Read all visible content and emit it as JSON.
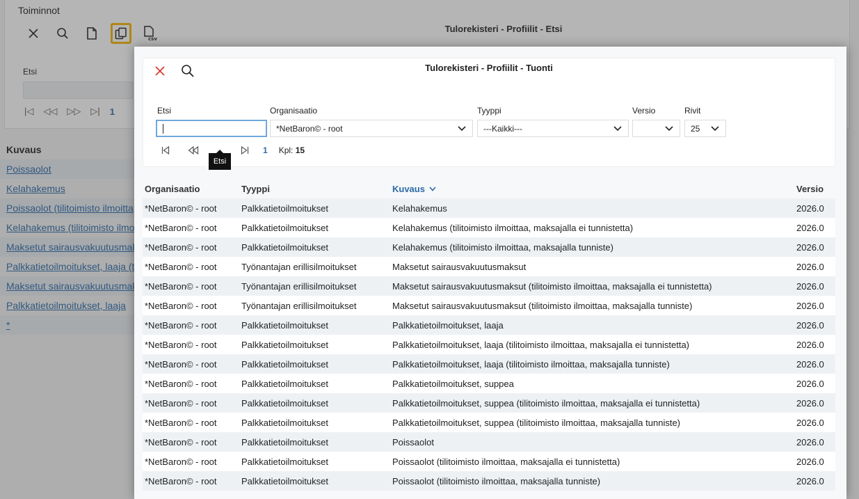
{
  "background": {
    "section_title": "Toiminnot",
    "page_title": "Tulorekisteri - Profiilit - Etsi",
    "search_label": "Etsi",
    "pager_page": "1",
    "list_header": "Kuvaus",
    "list_items": [
      "Poissaolot",
      "Kelahakemus",
      "Poissaolot (tilitoimisto ilmoitta",
      "Kelahakemus (tilitoimisto ilmo",
      "Maksetut sairausvakuutusmak",
      "Palkkatietoilmoitukset, laaja (ti",
      "Maksetut sairausvakuutusmak",
      "Palkkatietoilmoitukset, laaja",
      "*"
    ],
    "toolbar_icons": [
      "close-icon",
      "search-icon",
      "new-document-icon",
      "copy-icon",
      "csv-export-icon"
    ]
  },
  "modal": {
    "title": "Tulorekisteri - Profiilit - Tuonti",
    "filters": {
      "search_label": "Etsi",
      "search_value": "",
      "organisation_label": "Organisaatio",
      "organisation_value": "*NetBaron© - root",
      "type_label": "Tyyppi",
      "type_value": "---Kaikki---",
      "version_label": "Versio",
      "version_value": "",
      "rows_label": "Rivit",
      "rows_value": "25"
    },
    "pager": {
      "page": "1",
      "count_label": "Kpl:",
      "count_value": "15"
    },
    "tooltip": "Etsi",
    "table": {
      "headers": {
        "organisation": "Organisaatio",
        "type": "Tyyppi",
        "description": "Kuvaus",
        "version": "Versio"
      },
      "rows": [
        {
          "org": "*NetBaron© - root",
          "type": "Palkkatietoilmoitukset",
          "desc": "Kelahakemus",
          "version": "2026.0"
        },
        {
          "org": "*NetBaron© - root",
          "type": "Palkkatietoilmoitukset",
          "desc": "Kelahakemus (tilitoimisto ilmoittaa, maksajalla ei tunnistetta)",
          "version": "2026.0"
        },
        {
          "org": "*NetBaron© - root",
          "type": "Palkkatietoilmoitukset",
          "desc": "Kelahakemus (tilitoimisto ilmoittaa, maksajalla tunniste)",
          "version": "2026.0"
        },
        {
          "org": "*NetBaron© - root",
          "type": "Työnantajan erillisilmoitukset",
          "desc": "Maksetut sairausvakuutusmaksut",
          "version": "2026.0"
        },
        {
          "org": "*NetBaron© - root",
          "type": "Työnantajan erillisilmoitukset",
          "desc": "Maksetut sairausvakuutusmaksut (tilitoimisto ilmoittaa, maksajalla ei tunnistetta)",
          "version": "2026.0"
        },
        {
          "org": "*NetBaron© - root",
          "type": "Työnantajan erillisilmoitukset",
          "desc": "Maksetut sairausvakuutusmaksut (tilitoimisto ilmoittaa, maksajalla tunniste)",
          "version": "2026.0"
        },
        {
          "org": "*NetBaron© - root",
          "type": "Palkkatietoilmoitukset",
          "desc": "Palkkatietoilmoitukset, laaja",
          "version": "2026.0"
        },
        {
          "org": "*NetBaron© - root",
          "type": "Palkkatietoilmoitukset",
          "desc": "Palkkatietoilmoitukset, laaja (tilitoimisto ilmoittaa, maksajalla ei tunnistetta)",
          "version": "2026.0"
        },
        {
          "org": "*NetBaron© - root",
          "type": "Palkkatietoilmoitukset",
          "desc": "Palkkatietoilmoitukset, laaja (tilitoimisto ilmoittaa, maksajalla tunniste)",
          "version": "2026.0"
        },
        {
          "org": "*NetBaron© - root",
          "type": "Palkkatietoilmoitukset",
          "desc": "Palkkatietoilmoitukset, suppea",
          "version": "2026.0"
        },
        {
          "org": "*NetBaron© - root",
          "type": "Palkkatietoilmoitukset",
          "desc": "Palkkatietoilmoitukset, suppea (tilitoimisto ilmoittaa, maksajalla ei tunnistetta)",
          "version": "2026.0"
        },
        {
          "org": "*NetBaron© - root",
          "type": "Palkkatietoilmoitukset",
          "desc": "Palkkatietoilmoitukset, suppea (tilitoimisto ilmoittaa, maksajalla tunniste)",
          "version": "2026.0"
        },
        {
          "org": "*NetBaron© - root",
          "type": "Palkkatietoilmoitukset",
          "desc": "Poissaolot",
          "version": "2026.0"
        },
        {
          "org": "*NetBaron© - root",
          "type": "Palkkatietoilmoitukset",
          "desc": "Poissaolot (tilitoimisto ilmoittaa, maksajalla ei tunnistetta)",
          "version": "2026.0"
        },
        {
          "org": "*NetBaron© - root",
          "type": "Palkkatietoilmoitukset",
          "desc": "Poissaolot (tilitoimisto ilmoittaa, maksajalla tunniste)",
          "version": "2026.0"
        }
      ]
    }
  },
  "colors": {
    "accent": "#2b6aa8",
    "active_outline": "#f5b400",
    "close_red": "#d9342b",
    "row_stripe": "#eef1f4"
  }
}
